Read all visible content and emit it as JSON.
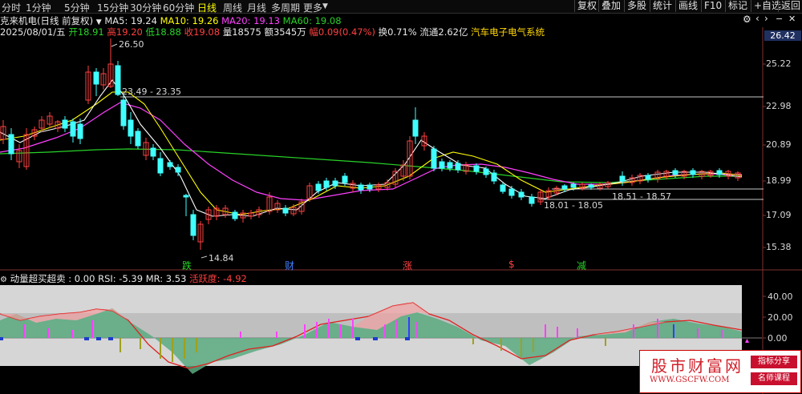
{
  "toolbar": {
    "tabs": [
      "分时",
      "1分钟",
      "5分钟",
      "15分钟",
      "30分钟",
      "60分钟",
      "日线",
      "周线",
      "月线",
      "多周期",
      "更多"
    ],
    "active_tab": "日线",
    "right_buttons": [
      "复权",
      "叠加",
      "多股",
      "统计",
      "画线",
      "F10",
      "标记",
      "+自选",
      "返回"
    ]
  },
  "stock": {
    "title": "克来机电(日线 前复权)",
    "ma5": "MA5: 19.24",
    "ma10": "MA10: 19.26",
    "ma20": "MA20: 19.13",
    "ma60": "MA60: 19.08"
  },
  "quote": {
    "date": "2025/08/01/五",
    "open": "开18.91",
    "high": "高19.20",
    "low": "低18.88",
    "close": "收19.08",
    "volume": "量18575",
    "amount": "额3545万",
    "change": "幅0.09(0.47%)",
    "turnover": "换0.71%",
    "float": "流通2.62亿",
    "sector": "汽车电子电气系统"
  },
  "price_axis": {
    "current": "26.42",
    "ticks": [
      "25.22",
      "22.98",
      "20.89",
      "18.99",
      "17.09",
      "15.38"
    ]
  },
  "annotations": {
    "high_label": "26.50",
    "low_label": "14.84",
    "range1": "23.49 - 23.35",
    "range2": "18.51 - 18.57",
    "range3": "18.01 - 18.05"
  },
  "signals": [
    {
      "label": "跌",
      "color": "#28d228"
    },
    {
      "label": "财",
      "color": "#4080ff"
    },
    {
      "label": "涨",
      "color": "#ff4040"
    },
    {
      "label": "$",
      "color": "#ff4040"
    },
    {
      "label": "减",
      "color": "#28d228"
    }
  ],
  "indicator": {
    "name": "动量超买超卖 : 0.00",
    "rsi": "RSI: -5.39",
    "mr": "MR: 3.53",
    "activity": "活跃度: -4.92",
    "ticks": [
      "40.00",
      "20.00",
      "0.00"
    ]
  },
  "watermark": {
    "site": "股市财富网",
    "url": "WWW.GSCFW.COM",
    "tag1": "指标分享",
    "tag2": "名师课程"
  },
  "colors": {
    "up": "#ff4040",
    "down": "#40ffff",
    "ma5": "#ffffff",
    "ma10": "#ffff00",
    "ma20": "#ff40ff",
    "ma60": "#28d228"
  }
}
